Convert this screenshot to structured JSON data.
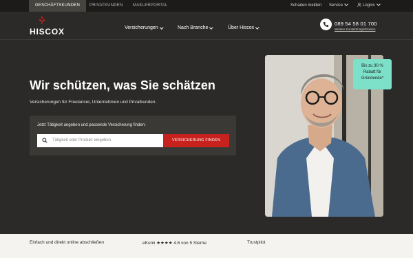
{
  "topbar": {
    "tabs": [
      "GESCHÄFTSKUNDEN",
      "PRIVATKUNDEN",
      "MAKLERPORTAL"
    ],
    "schaden": "Schaden melden",
    "service": "Service",
    "logins": "Logins"
  },
  "header": {
    "logo_text": "HISCOX",
    "nav": [
      "Versicherungen",
      "Nach Branche",
      "Über Hiscox"
    ],
    "phone": "089 54 58 01 700",
    "phone_sub": "Weitere Kontaktmöglichkeiten"
  },
  "hero": {
    "headline": "Wir schützen, was Sie schätzen",
    "subline": "Versicherungen für Freelancer, Unternehmen und Privatkunden.",
    "search_label": "Jetzt Tätigkeit angeben und passende Versicherung finden:",
    "search_placeholder": "Tätigkeit oder Produkt eingeben",
    "search_button": "VERSICHERUNG FINDEN",
    "badge_lines": [
      "Bis zu 30 %",
      "Rabatt für",
      "Gründende*"
    ]
  },
  "strip": {
    "item1": "Einfach und direkt online abschließen",
    "item2": "eKomi ★★★★  4.6 von 5 Sterne",
    "item3": "Trustpilot"
  },
  "colors": {
    "brand_red": "#c8221f",
    "badge_mint": "#7de0c8",
    "background": "#2b2a29"
  }
}
